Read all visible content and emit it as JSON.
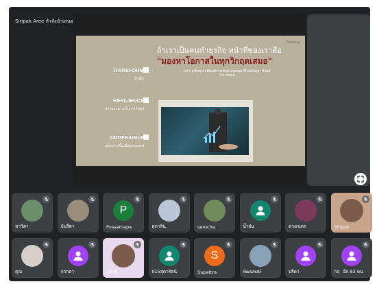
{
  "host": {
    "label": "Siripak Aree กำลังนำเสนอ"
  },
  "slide": {
    "brand": "TKiplang",
    "headline": "ถ้าเราเป็นคนทำธุรกิจ หน้าที่ของเราคือ",
    "headline_highlight": "\"มองหาโอกาสในทุกวิกฤตเสมอ\"",
    "desc": "เพราะธุรกิจทุกวันนี้ต้องมีการปรับตัวอยู่ตลอด ที่ไหนมีปัญหา ที่นั่นมีโอกาสเสมอ",
    "keywords": [
      {
        "title": "TrANSFORM",
        "sub": "ปรับตัว"
      },
      {
        "title": "RESILIENCE",
        "sub": "ความสามารถในการล้มลุก"
      },
      {
        "title": "ANTIFRAGILE",
        "sub": "แข็งแกร่งขึ้นเมื่อถูกทดสอบ"
      }
    ]
  },
  "participants_row1": [
    {
      "name": "ชาวิตา",
      "kind": "photo",
      "color": "#6b8f6a"
    },
    {
      "name": "บันรีตา",
      "kind": "photo",
      "color": "#9a8c7a"
    },
    {
      "name": "Pussamapa",
      "kind": "letter",
      "letter": "P",
      "color": "#188038"
    },
    {
      "name": "สุภาลิน",
      "kind": "photo",
      "color": "#b9c6d8"
    },
    {
      "name": "sarocha",
      "kind": "photo",
      "color": "#6f8c5c"
    },
    {
      "name": "น้ำฝน",
      "kind": "person",
      "color": "#12866e"
    },
    {
      "name": "ดวงเนตร",
      "kind": "photo",
      "color": "#7c3a5a"
    },
    {
      "name": "Siripak",
      "kind": "video",
      "color": "#c7a48a"
    }
  ],
  "participants_row2": [
    {
      "name": "คุณ",
      "kind": "photo",
      "color": "#d7cfc8"
    },
    {
      "name": "กกกดา",
      "kind": "person",
      "color": "#a142f4"
    },
    {
      "name": "ภูลิษฐ์",
      "kind": "video",
      "color": "#e9d9ee"
    },
    {
      "name": "015สุดารัตน์",
      "kind": "person",
      "color": "#12866e"
    },
    {
      "name": "Supattra",
      "kind": "letter",
      "letter": "S",
      "color": "#f06b1a"
    },
    {
      "name": "พัฒนพงษ์",
      "kind": "photo",
      "color": "#8aa2b8"
    },
    {
      "name": "ปรีดา",
      "kind": "person",
      "color": "#a142f4"
    },
    {
      "name": "กฤ",
      "extra": "อีก 83 คน",
      "kind": "person",
      "color": "#a142f4"
    }
  ]
}
